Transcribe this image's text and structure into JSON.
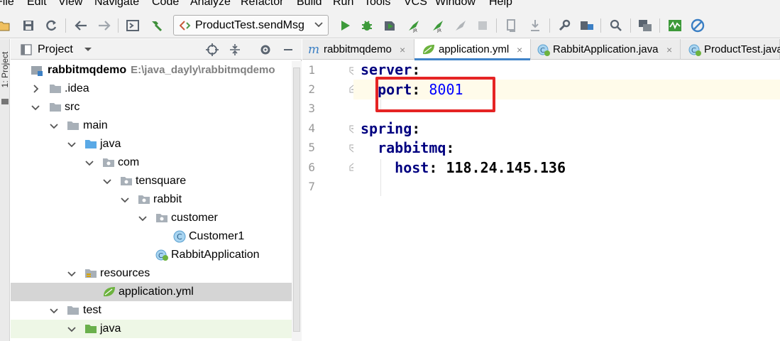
{
  "menu": [
    "File",
    "Edit",
    "View",
    "Navigate",
    "Code",
    "Analyze",
    "Refactor",
    "Build",
    "Run",
    "Tools",
    "VCS",
    "Window",
    "Help"
  ],
  "toolbar": {
    "run_config": "ProductTest.sendMsg",
    "icons": [
      "open-icon",
      "save-icon",
      "sync-icon",
      "back-icon",
      "forward-icon",
      "terminal-icon",
      "build-hammer-icon",
      "run-icon",
      "debug-icon",
      "coverage-icon",
      "profile-icon",
      "profile-jr-icon",
      "build-artifact-icon",
      "stop-icon",
      "vcs-update-icon",
      "vcs-commit-icon",
      "settings-icon",
      "project-structure-icon",
      "search-icon",
      "sdk-icon",
      "stats-icon",
      "power-save-icon"
    ]
  },
  "sidestrip": {
    "label": "1: Project"
  },
  "project_panel": {
    "title": "Project",
    "tree": [
      {
        "label": "rabbitmqdemo",
        "path": "E:\\java_dayly\\rabbitmqdemo",
        "depth": 0,
        "expanded": true,
        "icon": "module-icon",
        "bold": true
      },
      {
        "label": ".idea",
        "depth": 1,
        "expanded": false,
        "icon": "folder-icon"
      },
      {
        "label": "src",
        "depth": 1,
        "expanded": true,
        "icon": "folder-icon"
      },
      {
        "label": "main",
        "depth": 2,
        "expanded": true,
        "icon": "folder-icon"
      },
      {
        "label": "java",
        "depth": 3,
        "expanded": true,
        "icon": "source-folder-icon"
      },
      {
        "label": "com",
        "depth": 4,
        "expanded": true,
        "icon": "package-icon"
      },
      {
        "label": "tensquare",
        "depth": 5,
        "expanded": true,
        "icon": "package-icon"
      },
      {
        "label": "rabbit",
        "depth": 6,
        "expanded": true,
        "icon": "package-icon"
      },
      {
        "label": "customer",
        "depth": 7,
        "expanded": true,
        "icon": "package-icon"
      },
      {
        "label": "Customer1",
        "depth": 8,
        "icon": "class-icon"
      },
      {
        "label": "RabbitApplication",
        "depth": 7,
        "icon": "spring-class-icon"
      },
      {
        "label": "resources",
        "depth": 3,
        "expanded": true,
        "icon": "resources-folder-icon"
      },
      {
        "label": "application.yml",
        "depth": 4,
        "icon": "yaml-spring-icon",
        "selected": true
      },
      {
        "label": "test",
        "depth": 2,
        "expanded": true,
        "icon": "folder-icon"
      },
      {
        "label": "java",
        "depth": 3,
        "expanded": true,
        "icon": "test-folder-icon",
        "highlight": true
      }
    ]
  },
  "editor": {
    "tabs": [
      {
        "label": "rabbitmqdemo",
        "icon": "maven-icon",
        "active": false,
        "close": "×"
      },
      {
        "label": "application.yml",
        "icon": "yaml-spring-icon",
        "active": true,
        "close": "×"
      },
      {
        "label": "RabbitApplication.java",
        "icon": "spring-class-icon",
        "active": false,
        "close": "×"
      },
      {
        "label": "ProductTest.java",
        "icon": "spring-class-icon",
        "active": false,
        "close": ""
      }
    ],
    "line_numbers": [
      "1",
      "2",
      "3",
      "4",
      "5",
      "6",
      "7"
    ],
    "lines": [
      {
        "indent": "",
        "key": "server",
        "colon": ":",
        "value": ""
      },
      {
        "indent": "  ",
        "key": "port",
        "colon": ": ",
        "value": "8001"
      },
      {
        "indent": "",
        "key": "",
        "colon": "",
        "value": ""
      },
      {
        "indent": "",
        "key": "spring",
        "colon": ":",
        "value": ""
      },
      {
        "indent": "  ",
        "key": "rabbitmq",
        "colon": ":",
        "value": ""
      },
      {
        "indent": "    ",
        "key": "host",
        "colon": ": ",
        "value": "118.24.145.136"
      },
      {
        "indent": "",
        "key": "",
        "colon": "",
        "value": ""
      }
    ],
    "annotation_color": "#e52424"
  }
}
